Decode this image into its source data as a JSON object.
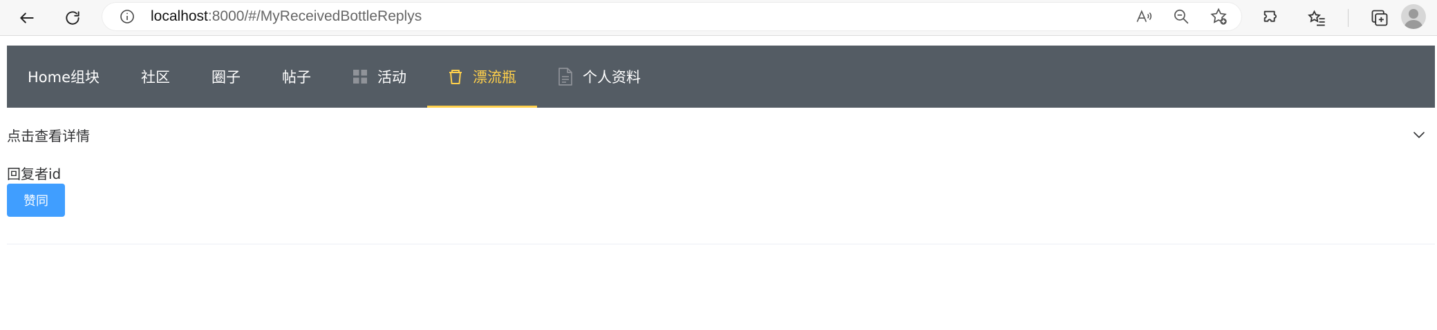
{
  "browser": {
    "url_host": "localhost",
    "url_rest": ":8000/#/MyReceivedBottleReplys",
    "icons": [
      "back-icon",
      "reload-icon",
      "info-icon",
      "read-aloud-icon",
      "zoom-out-icon",
      "add-favorite-icon",
      "extensions-icon",
      "favorites-icon",
      "collections-icon",
      "profile-icon"
    ]
  },
  "nav": {
    "items": [
      {
        "label": "Home组块",
        "icon": ""
      },
      {
        "label": "社区",
        "icon": ""
      },
      {
        "label": "圈子",
        "icon": ""
      },
      {
        "label": "帖子",
        "icon": ""
      },
      {
        "label": "活动",
        "icon": "grid-icon"
      },
      {
        "label": "漂流瓶",
        "icon": "cup-icon",
        "active": true
      },
      {
        "label": "个人资料",
        "icon": "document-icon"
      }
    ],
    "active_color": "#ffd04b",
    "background": "#545c64"
  },
  "collapse": {
    "title": "点击查看详情",
    "replier_label": "回复者id",
    "agree_button": "赞同"
  },
  "colors": {
    "primary": "#409eff"
  }
}
